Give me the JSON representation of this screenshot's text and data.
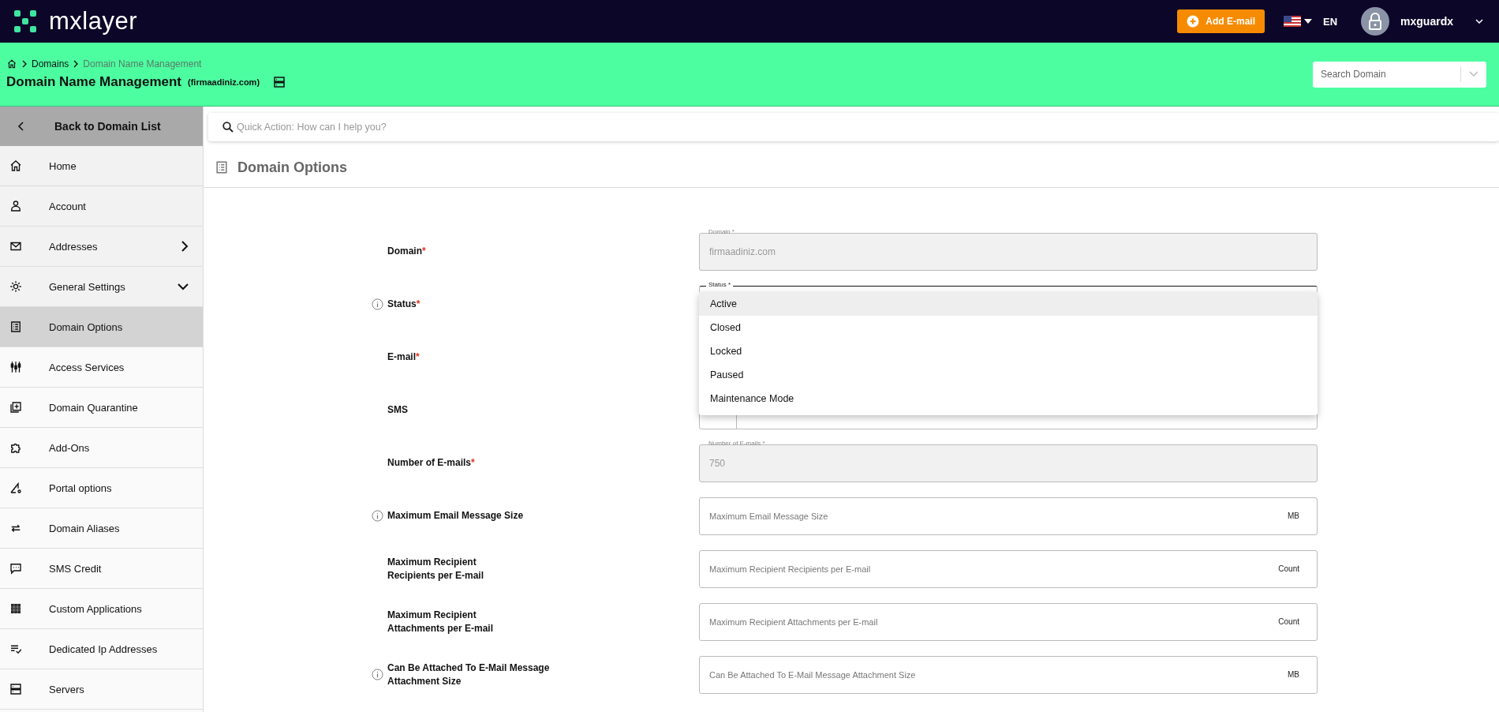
{
  "topbar": {
    "logo": "mxlayer",
    "add_button": "Add E-mail",
    "language": "EN",
    "username": "mxguardx"
  },
  "page_header": {
    "breadcrumbs": [
      {
        "label": "Domains",
        "current": false
      },
      {
        "label": "Domain Name Management",
        "current": true
      }
    ],
    "title": "Domain Name Management",
    "subtitle": "(firmaadiniz.com)",
    "search": {
      "placeholder": "Search Domain"
    }
  },
  "sidebar": {
    "back": "Back to Domain List",
    "items": [
      {
        "label": "Home",
        "kind": "link",
        "selected": false
      },
      {
        "label": "Account",
        "kind": "link",
        "selected": false
      },
      {
        "label": "Addresses",
        "kind": "submenu",
        "selected": false
      },
      {
        "label": "General Settings",
        "kind": "group",
        "selected": false
      },
      {
        "label": "Domain Options",
        "kind": "link",
        "selected": true
      },
      {
        "label": "Access Services",
        "kind": "link",
        "selected": false
      },
      {
        "label": "Domain Quarantine",
        "kind": "link",
        "selected": false
      },
      {
        "label": "Add-Ons",
        "kind": "link",
        "selected": false
      },
      {
        "label": "Portal options",
        "kind": "link",
        "selected": false
      },
      {
        "label": "Domain Aliases",
        "kind": "link",
        "selected": false
      },
      {
        "label": "SMS Credit",
        "kind": "link",
        "selected": false
      },
      {
        "label": "Custom Applications",
        "kind": "link",
        "selected": false
      },
      {
        "label": "Dedicated Ip Addresses",
        "kind": "link",
        "selected": false
      },
      {
        "label": "Servers",
        "kind": "link",
        "selected": false
      }
    ]
  },
  "quick_action": {
    "placeholder": "Quick Action: How can I help you?"
  },
  "section_title": "Domain Options",
  "form": [
    {
      "label": "Domain",
      "required_mark": "*",
      "info": false,
      "kind": "readonly",
      "field_label": "Domain *",
      "value": "firmaadiniz.com"
    },
    {
      "label": "Status",
      "required_mark": "*",
      "info": true,
      "kind": "select",
      "field_label": "Status *",
      "options": [
        {
          "label": "Active",
          "selected": true
        },
        {
          "label": "Closed",
          "selected": false
        },
        {
          "label": "Locked",
          "selected": false
        },
        {
          "label": "Paused",
          "selected": false
        },
        {
          "label": "Maintenance Mode",
          "selected": false
        }
      ]
    },
    {
      "label": "E-mail",
      "required_mark": "*",
      "info": false,
      "kind": "covered"
    },
    {
      "label": "SMS",
      "info": false,
      "kind": "phone"
    },
    {
      "label": "Number of E-mails",
      "required_mark": "*",
      "info": false,
      "kind": "readonly",
      "field_label": "Number of E-mails *",
      "value": "750"
    },
    {
      "label": "Maximum Email Message Size",
      "info": true,
      "kind": "unit",
      "placeholder": "Maximum Email Message Size",
      "unit": "MB"
    },
    {
      "label": "Maximum Recipient\nRecipients per E-mail",
      "info": false,
      "kind": "unit",
      "placeholder": "Maximum Recipient Recipients per E-mail",
      "unit": "Count"
    },
    {
      "label": "Maximum Recipient\nAttachments per E-mail",
      "info": false,
      "kind": "unit",
      "placeholder": "Maximum Recipient Attachments per E-mail",
      "unit": "Count"
    },
    {
      "label": "Can Be Attached To E-Mail Message\nAttachment Size",
      "info": true,
      "kind": "unit",
      "placeholder": "Can Be Attached To E-Mail Message Attachment Size",
      "unit": "MB"
    }
  ]
}
